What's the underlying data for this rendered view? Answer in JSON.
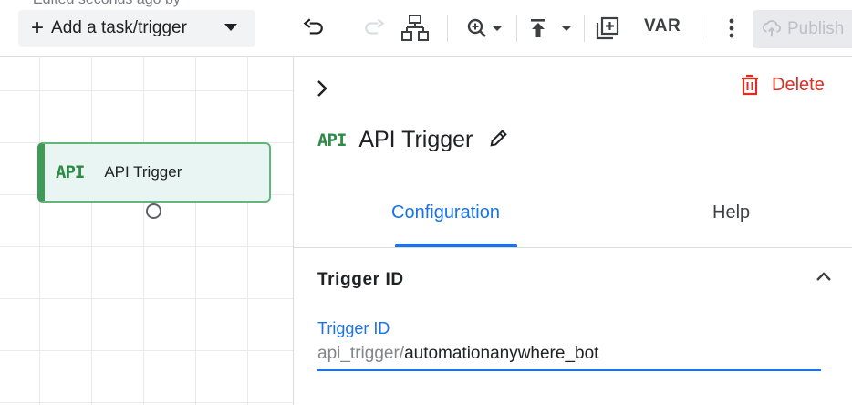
{
  "header": {
    "edited_text": "Edited seconds ago by "
  },
  "toolbar": {
    "add_label": "Add a task/trigger",
    "var_label": "VAR",
    "publish_label": "Publish",
    "icons": [
      "plus-icon",
      "caret-down-icon",
      "undo-icon",
      "redo-icon",
      "auto-layout-icon",
      "zoom-in-icon",
      "upload-icon",
      "add-box-icon",
      "more-vert-icon",
      "publish-icon"
    ]
  },
  "canvas": {
    "node": {
      "tag": "API",
      "label": "API Trigger"
    }
  },
  "panel": {
    "delete_label": "Delete",
    "tag": "API",
    "title": "API Trigger",
    "tabs": [
      {
        "label": "Configuration",
        "active": true
      },
      {
        "label": "Help",
        "active": false
      }
    ],
    "section": {
      "title": "Trigger ID",
      "field_label": "Trigger ID",
      "field_prefix": "api_trigger/",
      "field_value": "automationanywhere_bot"
    }
  },
  "colors": {
    "accent": "#1a73e8",
    "delete": "#d93025",
    "node_border": "#3f9a57",
    "node_fill": "#e8f5f2"
  }
}
